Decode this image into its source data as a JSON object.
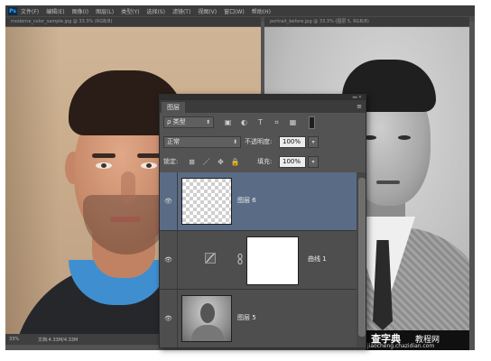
{
  "app": {
    "logo": "Ps",
    "menus": [
      "文件(F)",
      "编辑(E)",
      "图像(I)",
      "图层(L)",
      "类型(Y)",
      "选择(S)",
      "滤镜(T)",
      "视图(V)",
      "窗口(W)",
      "帮助(H)"
    ]
  },
  "documents": {
    "left_tab": "moderne_color_sample.jpg @ 33.3% (RGB/8)",
    "right_tab": "portrait_before.jpg @ 33.3% (图层 5, RGB/8)"
  },
  "status": {
    "zoom": "33%",
    "doc_info": "文档:4.33M/4.33M"
  },
  "layers_panel": {
    "collapse_glyph": "◂◂ ✕",
    "tab_label": "图层",
    "menu_glyph": "≡",
    "filter": {
      "kind_label": "ρ 类型",
      "arrow": "⬍",
      "icons": [
        "▣",
        "◐",
        "T",
        "⌗",
        "▦"
      ],
      "icon_names": [
        "pixel-filter-icon",
        "adjustment-filter-icon",
        "type-filter-icon",
        "shape-filter-icon",
        "smart-object-filter-icon"
      ]
    },
    "blend": {
      "mode": "正常",
      "arrow": "⬍",
      "opacity_label": "不透明度:",
      "opacity_value": "100%",
      "stepper": "▾"
    },
    "lock": {
      "label": "锁定:",
      "icons": [
        "⊠",
        "／",
        "✥",
        "🔒"
      ],
      "icon_names": [
        "lock-transparent-icon",
        "lock-pixels-icon",
        "lock-position-icon",
        "lock-all-icon"
      ],
      "fill_label": "填充:",
      "fill_value": "100%",
      "stepper": "▾"
    },
    "layers": [
      {
        "name": "图层 6",
        "visible_icon": "👁",
        "selected": true
      },
      {
        "name": "曲线 1",
        "visible_icon": "👁",
        "selected": false
      },
      {
        "name": "图层 5",
        "visible_icon": "👁",
        "selected": false
      }
    ],
    "colors": {
      "selected_row": "#5a6c85",
      "panel_bg": "#535353"
    }
  },
  "watermark": {
    "main": "查字典",
    "sub": "教程网",
    "url": "jiaocheng.chazidian.com"
  }
}
